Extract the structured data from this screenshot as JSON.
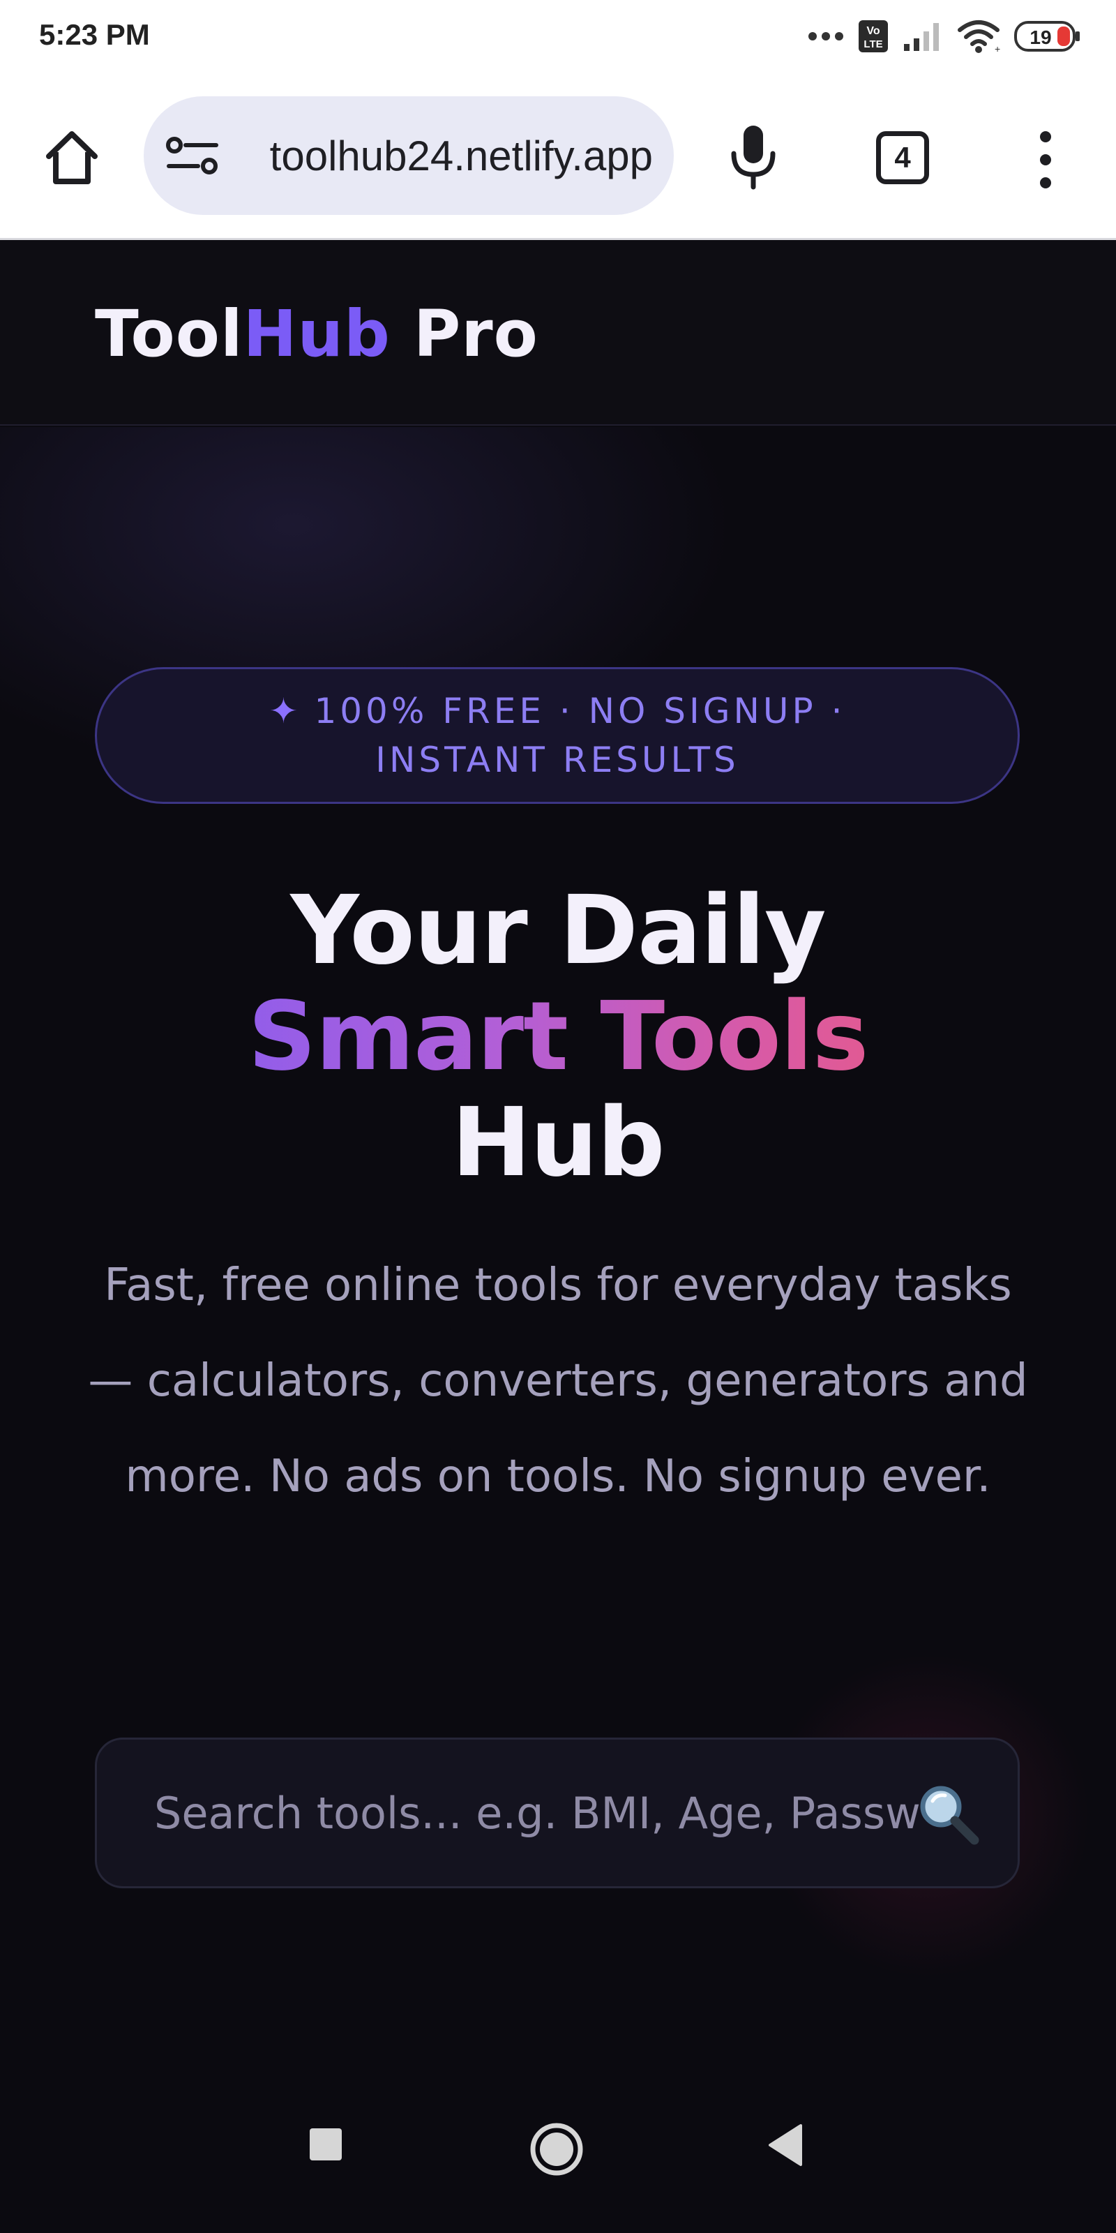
{
  "status_bar": {
    "time": "5:23 PM",
    "battery_level": "19",
    "icons": [
      "dots-icon",
      "volte-icon",
      "signal-icon",
      "wifi-icon",
      "battery-icon"
    ]
  },
  "browser": {
    "url": "toolhub24.netlify.app",
    "tab_count": "4",
    "icons": [
      "home-icon",
      "site-settings-icon",
      "mic-icon",
      "tabs-icon",
      "more-menu-icon"
    ]
  },
  "site": {
    "logo_part1": "Tool",
    "logo_part2": "Hub",
    "logo_part3": " Pro",
    "accent_color": "#7b5cf6"
  },
  "hero": {
    "badge_icon": "✦",
    "badge_text": "100% FREE · NO SIGNUP · INSTANT RESULTS",
    "headline_line1": "Your Daily",
    "headline_line2": "Smart Tools",
    "headline_line3": "Hub",
    "subtitle": "Fast, free online tools for everyday tasks — calculators, converters, generators and more. No ads on tools. No signup ever.",
    "search_placeholder": "Search tools... e.g. BMI, Age, Password",
    "gradient_colors": [
      "#7c5cf7",
      "#b35fd6",
      "#d85aa6",
      "#ef5a77"
    ]
  },
  "nav_bar": {
    "icons": [
      "recents-icon",
      "home-circle-icon",
      "back-icon"
    ]
  }
}
